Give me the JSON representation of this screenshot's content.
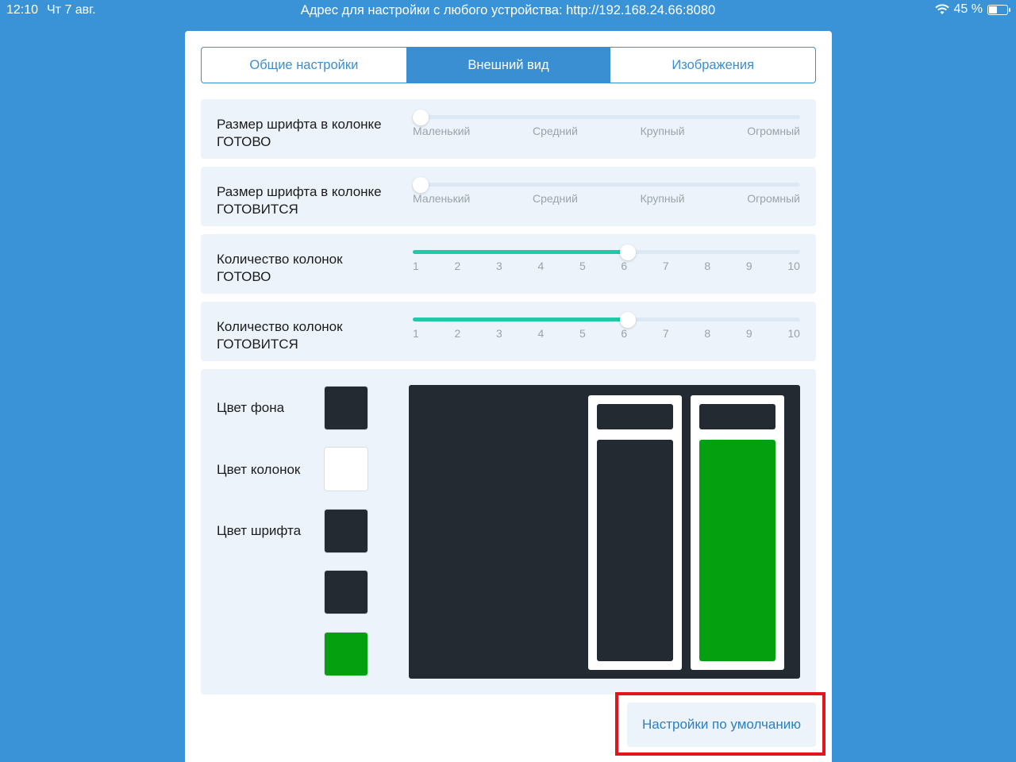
{
  "statusbar": {
    "time": "12:10",
    "date": "Чт 7 авг.",
    "address": "Адрес для настройки с любого устройства: http://192.168.24.66:8080",
    "battery": "45 %",
    "battery_level": 0.45
  },
  "tabs": [
    {
      "label": "Общие настройки",
      "active": false
    },
    {
      "label": "Внешний вид",
      "active": true
    },
    {
      "label": "Изображения",
      "active": false
    }
  ],
  "settings": [
    {
      "label_line1": "Размер шрифта в колонке",
      "label_line2": "ГОТОВО",
      "ticks": [
        "Маленький",
        "Средний",
        "Крупный",
        "Огромный"
      ],
      "value": "Маленький",
      "fraction": 0.0
    },
    {
      "label_line1": "Размер шрифта в колонке",
      "label_line2": "ГОТОВИТСЯ",
      "ticks": [
        "Маленький",
        "Средний",
        "Крупный",
        "Огромный"
      ],
      "value": "Маленький",
      "fraction": 0.0
    },
    {
      "label_line1": "Количество колонок",
      "label_line2": "ГОТОВО",
      "ticks": [
        "1",
        "2",
        "3",
        "4",
        "5",
        "6",
        "7",
        "8",
        "9",
        "10"
      ],
      "value": "6",
      "fraction": 0.556
    },
    {
      "label_line1": "Количество колонок",
      "label_line2": "ГОТОВИТСЯ",
      "ticks": [
        "1",
        "2",
        "3",
        "4",
        "5",
        "6",
        "7",
        "8",
        "9",
        "10"
      ],
      "value": "6",
      "fraction": 0.556
    }
  ],
  "colors": {
    "background_label": "Цвет фона",
    "columns_label": "Цвет колонок",
    "font_label": "Цвет шрифта",
    "swatches": [
      "#232a31",
      "#ffffff",
      "#232a31",
      "#232a31",
      "#04a00f"
    ]
  },
  "reset_button": "Настройки по умолчанию",
  "theme": {
    "accent": "#3a8fd3",
    "slider_fill": "#23c8a6",
    "highlight": "#e2151b"
  }
}
